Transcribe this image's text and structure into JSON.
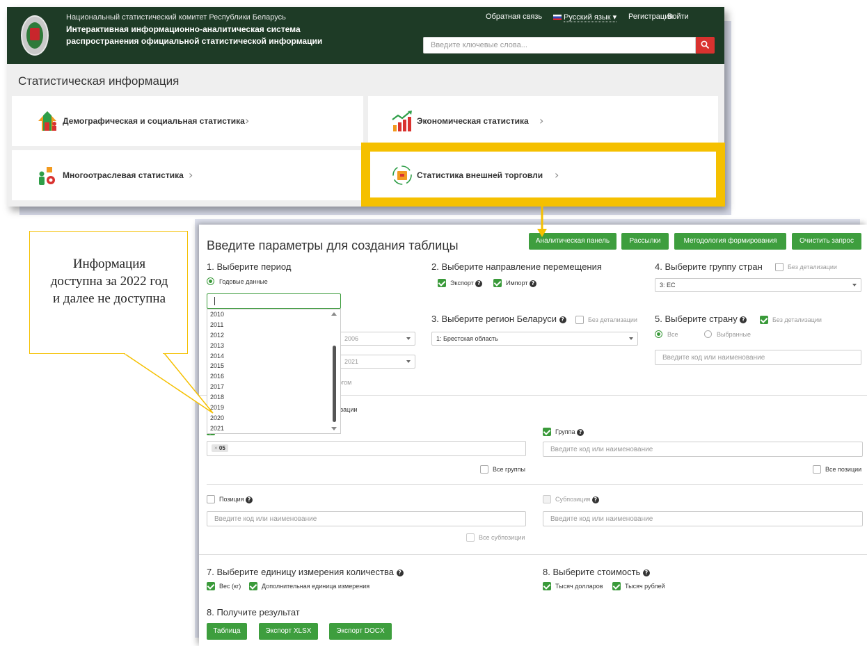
{
  "header": {
    "org": "Национальный статистический комитет Республики Беларусь",
    "system_line1": "Интерактивная информационно-аналитическая система",
    "system_line2": "распространения официальной статистической информации",
    "feedback": "Обратная связь",
    "language": "Русский язык",
    "register": "Регистрация",
    "login": "Войти",
    "search_placeholder": "Введите ключевые слова..."
  },
  "stat_section": {
    "title": "Статистическая информация",
    "cards": [
      {
        "label": "Демографическая и социальная статистика",
        "icon": "people-house-icon"
      },
      {
        "label": "Экономическая статистика",
        "icon": "bar-chart-icon"
      },
      {
        "label": "Многоотраслевая статистика",
        "icon": "people-gear-icon"
      },
      {
        "label": "Статистика внешней торговли",
        "icon": "trade-box-icon"
      }
    ]
  },
  "callout": {
    "line1": "Информация",
    "line2": "доступна за 2022 год",
    "line3": "и далее не доступна"
  },
  "form": {
    "title": "Введите параметры для создания таблицы",
    "top_buttons": [
      "Аналитическая панель",
      "Рассылки",
      "Методология формирования",
      "Очистить запрос"
    ],
    "step1": {
      "title": "1. Выберите период",
      "radio_annual": "Годовые данные",
      "years": [
        "2010",
        "2011",
        "2012",
        "2013",
        "2014",
        "2015",
        "2016",
        "2017",
        "2018",
        "2019",
        "2020",
        "2021"
      ],
      "from_value": "2006",
      "to_value": "2021",
      "partial_label": "огом"
    },
    "step2": {
      "title": "2. Выберите направление перемещения",
      "export": "Экспорт",
      "import": "Импорт"
    },
    "step3": {
      "title": "3. Выберите регион Беларуси",
      "no_detail": "Без детализации",
      "selected": "1: Брестская область"
    },
    "step4": {
      "title": "4. Выберите группу стран",
      "no_detail": "Без детализации",
      "selected": "3: ЕС"
    },
    "step5": {
      "title": "5. Выберите страну",
      "no_detail": "Без детализации",
      "radio_all": "Все",
      "radio_selected": "Выбранные",
      "placeholder": "Введите код или наименование"
    },
    "step6": {
      "partial_label": "изации",
      "tag": "05",
      "group_label": "Группа",
      "group_placeholder": "Введите код или наименование",
      "all_groups": "Все группы",
      "all_positions": "Все позиции",
      "position_label": "Позиция",
      "position_placeholder": "Введите код или наименование",
      "subposition_label": "Субпозиция",
      "subposition_placeholder": "Введите код или наименование",
      "all_subpositions": "Все субпозиции"
    },
    "step7": {
      "title": "7. Выберите единицу измерения количества",
      "weight": "Вес (кг)",
      "extra_unit": "Дополнительная единица измерения"
    },
    "step8a": {
      "title": "8. Выберите стоимость",
      "usd": "Тысяч долларов",
      "byn": "Тысяч рублей"
    },
    "step8b": {
      "title": "8. Получите результат",
      "buttons": [
        "Таблица",
        "Экспорт XLSX",
        "Экспорт DOCX"
      ]
    }
  },
  "colors": {
    "header_bg": "#1e3b26",
    "highlight": "#f5c000",
    "green_button": "#3e9e3e",
    "search_button": "#d9322f"
  }
}
